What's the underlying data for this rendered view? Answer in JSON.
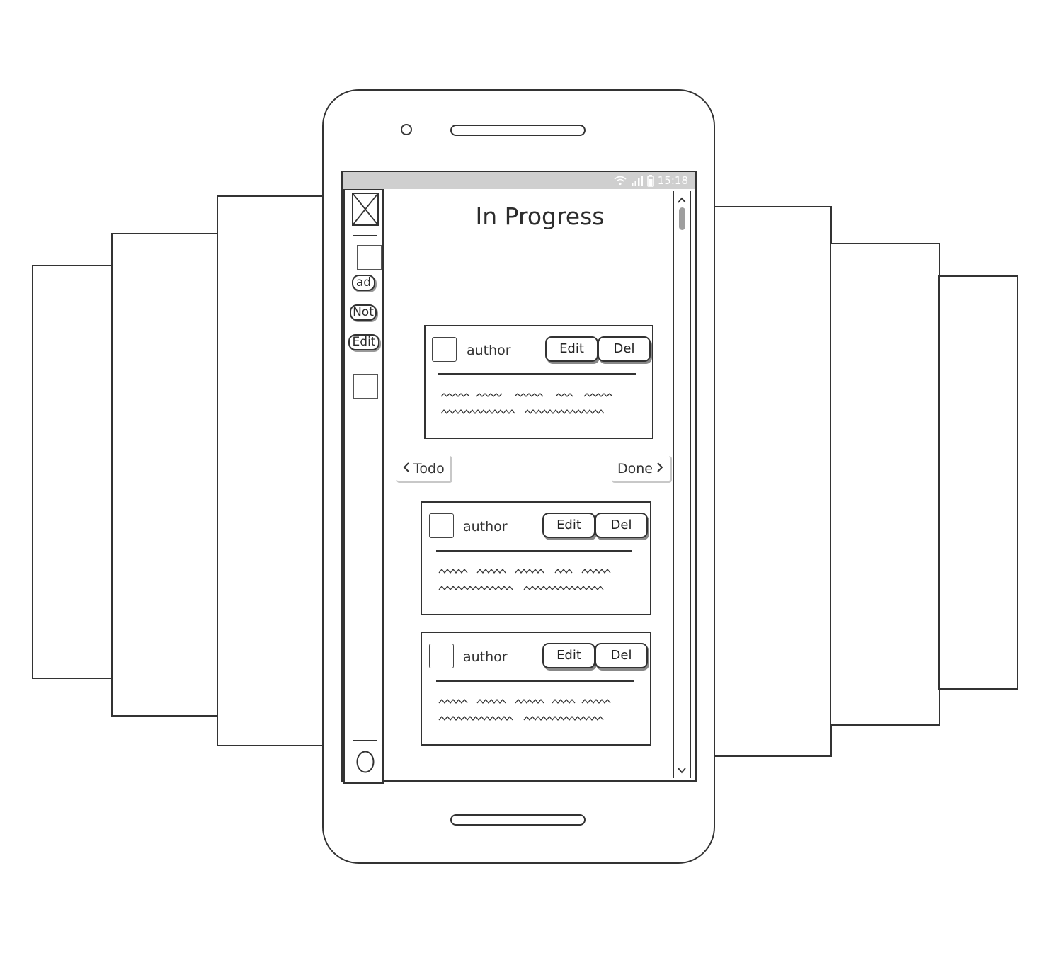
{
  "status_bar": {
    "time": "15:18",
    "wifi_icon": "wifi-icon",
    "signal_icon": "signal-icon",
    "battery_icon": "battery-icon"
  },
  "sidebar": {
    "logo_icon": "image-placeholder-icon",
    "buttons": [
      {
        "label": "ad"
      },
      {
        "label": "Not"
      },
      {
        "label": "Edit"
      }
    ],
    "footer_icon": "circle-icon"
  },
  "page": {
    "title": "In Progress"
  },
  "navigation": {
    "prev_label": "Todo",
    "next_label": "Done"
  },
  "cards": [
    {
      "author": "author",
      "edit_label": "Edit",
      "delete_label": "Del"
    },
    {
      "author": "author",
      "edit_label": "Edit",
      "delete_label": "Del"
    },
    {
      "author": "author",
      "edit_label": "Edit",
      "delete_label": "Del"
    }
  ],
  "colors": {
    "stroke": "#333333",
    "status_bar": "#cfcfcf",
    "scroll_thumb": "#9e9e9e"
  }
}
